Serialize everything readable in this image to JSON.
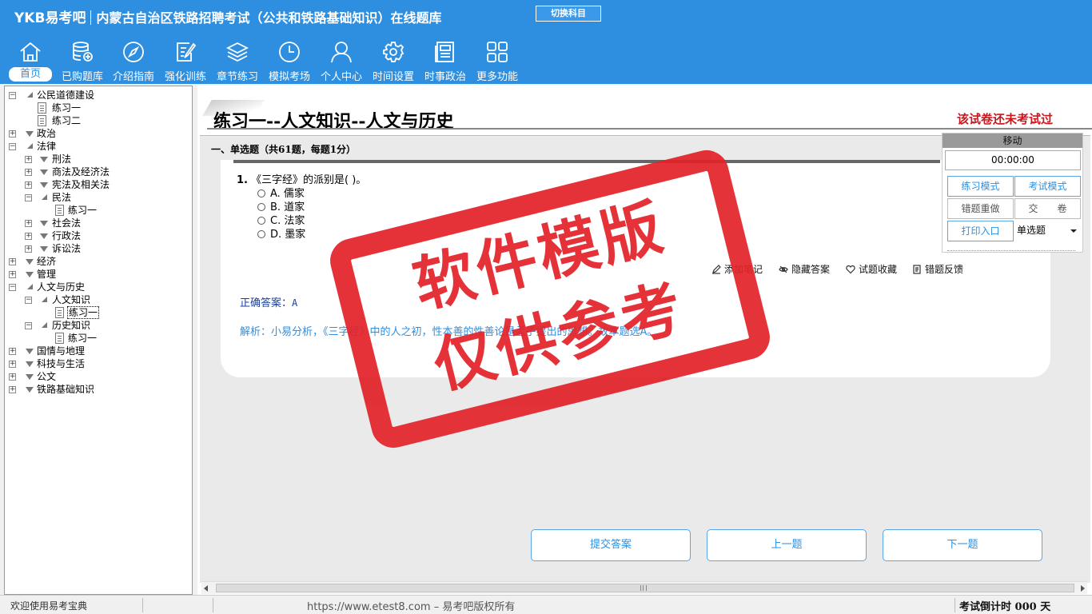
{
  "app": {
    "brand": "YKB易考吧",
    "title": "内蒙古自治区铁路招聘考试（公共和铁路基础知识）在线题库",
    "switch_subject": "切换科目"
  },
  "nav": {
    "items": [
      {
        "label": "首页",
        "icon": "home-icon"
      },
      {
        "label": "已购题库",
        "icon": "database-icon"
      },
      {
        "label": "介绍指南",
        "icon": "compass-icon"
      },
      {
        "label": "强化训练",
        "icon": "edit-icon"
      },
      {
        "label": "章节练习",
        "icon": "layers-icon"
      },
      {
        "label": "模拟考场",
        "icon": "clock-icon"
      },
      {
        "label": "个人中心",
        "icon": "user-icon"
      },
      {
        "label": "时间设置",
        "icon": "gear-icon"
      },
      {
        "label": "时事政治",
        "icon": "news-icon"
      },
      {
        "label": "更多功能",
        "icon": "grid-icon"
      }
    ]
  },
  "tree": {
    "nodes": [
      {
        "label": "公民道德建设"
      },
      {
        "label": "练习一"
      },
      {
        "label": "练习二"
      },
      {
        "label": "政治"
      },
      {
        "label": "法律"
      },
      {
        "label": "刑法"
      },
      {
        "label": "商法及经济法"
      },
      {
        "label": "宪法及相关法"
      },
      {
        "label": "民法"
      },
      {
        "label": "练习一"
      },
      {
        "label": "社会法"
      },
      {
        "label": "行政法"
      },
      {
        "label": "诉讼法"
      },
      {
        "label": "经济"
      },
      {
        "label": "管理"
      },
      {
        "label": "人文与历史"
      },
      {
        "label": "人文知识"
      },
      {
        "label": "练习一"
      },
      {
        "label": "历史知识"
      },
      {
        "label": "练习一"
      },
      {
        "label": "国情与地理"
      },
      {
        "label": "科技与生活"
      },
      {
        "label": "公文"
      },
      {
        "label": "铁路基础知识"
      }
    ]
  },
  "paper": {
    "title": "练习一--人文知识--人文与历史",
    "status": "该试卷还未考试过",
    "section_title": "一、单选题（共61题，每题1分）"
  },
  "question": {
    "number": "1.",
    "stem": "《三字经》的派别是( )。",
    "options": [
      "A. 儒家",
      "B. 道家",
      "C. 法家",
      "D. 墨家"
    ],
    "tools": {
      "note": "添加笔记",
      "hide_answer": "隐藏答案",
      "favorite": "试题收藏",
      "feedback": "错题反馈"
    },
    "answer_label": "正确答案：",
    "answer_value": "A",
    "analysis": "解析：小易分析，《三字经》中的人之初，性本善的性善论是孟子提出的思想。故本题选A。"
  },
  "actions": {
    "submit": "提交答案",
    "prev": "上一题",
    "next": "下一题"
  },
  "side_panel": {
    "header": "移动",
    "timer": "00:00:00",
    "practice_mode": "练习模式",
    "exam_mode": "考试模式",
    "redo_wrong": "错题重做",
    "hand_in": "交　　卷",
    "print": "打印入口",
    "qtype_selected": "单选题"
  },
  "stamp": {
    "line1": "软件模版",
    "line2": "仅供参考"
  },
  "statusbar": {
    "welcome": "欢迎使用易考宝典",
    "url": "https://www.etest8.com – 易考吧版权所有",
    "countdown": "考试倒计时 000 天"
  },
  "colors": {
    "header_bg": "#2e8fe0",
    "accent": "#2e8fe0",
    "status_red": "#c8161d",
    "stamp_red": "#e2232a"
  }
}
